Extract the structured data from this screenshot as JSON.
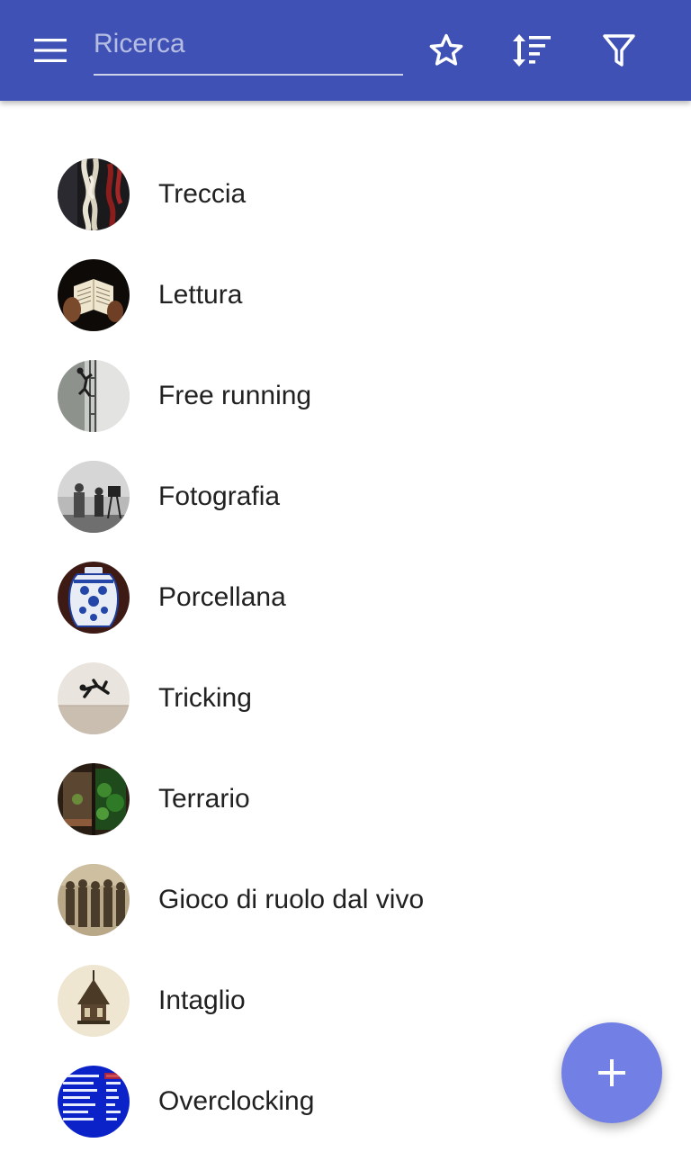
{
  "colors": {
    "appbar": "#3f51b5",
    "fab": "#7280e6",
    "text_primary": "#212121",
    "icon_on_appbar": "#ffffff"
  },
  "appbar": {
    "menu_icon": "hamburger-menu-icon",
    "search": {
      "placeholder": "Ricerca",
      "value": ""
    },
    "actions": [
      {
        "icon": "star-outline-icon"
      },
      {
        "icon": "sort-icon"
      },
      {
        "icon": "filter-icon"
      }
    ]
  },
  "items": [
    {
      "label": "Treccia",
      "thumb": "rope-braids"
    },
    {
      "label": "Lettura",
      "thumb": "open-book"
    },
    {
      "label": "Free running",
      "thumb": "climber-on-scaffold"
    },
    {
      "label": "Fotografia",
      "thumb": "vintage-photographers"
    },
    {
      "label": "Porcellana",
      "thumb": "blue-white-jar"
    },
    {
      "label": "Tricking",
      "thumb": "flipping-athlete"
    },
    {
      "label": "Terrario",
      "thumb": "glass-terrarium"
    },
    {
      "label": "Gioco di ruolo dal vivo",
      "thumb": "costumed-group"
    },
    {
      "label": "Intaglio",
      "thumb": "carved-pagoda"
    },
    {
      "label": "Overclocking",
      "thumb": "bios-screen"
    }
  ],
  "fab": {
    "icon": "plus-icon"
  }
}
